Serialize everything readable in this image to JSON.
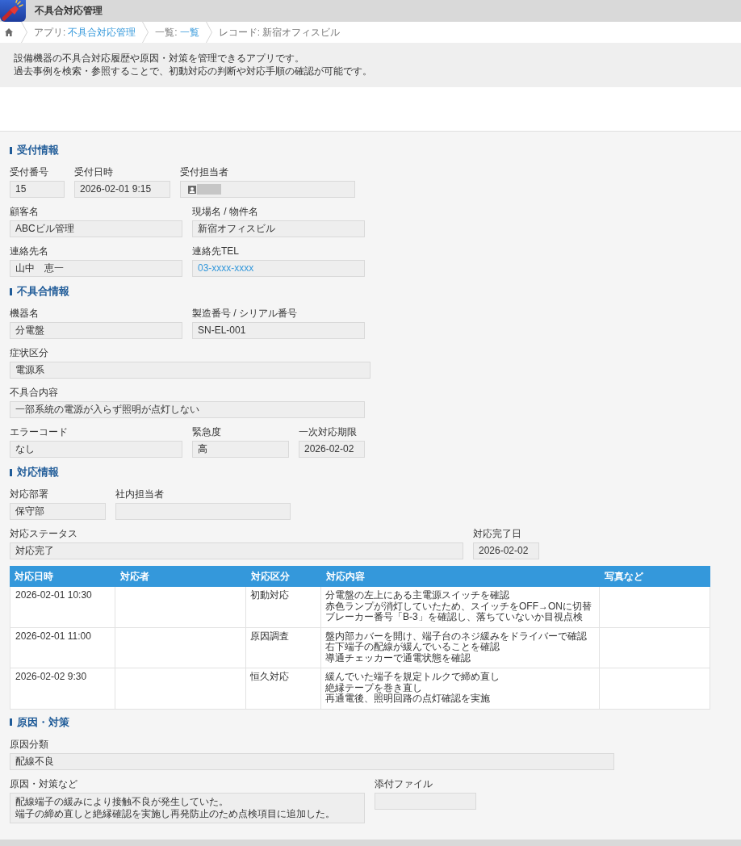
{
  "app": {
    "title": "不具合対応管理"
  },
  "breadcrumb": [
    {
      "kind": "link",
      "label": "アプリ:",
      "value": "不具合対応管理"
    },
    {
      "kind": "link",
      "label": "一覧:",
      "value": "一覧"
    },
    {
      "kind": "text",
      "label": "レコード:",
      "value": "新宿オフィスビル"
    }
  ],
  "description": [
    "設備機器の不具合対応履歴や原因・対策を管理できるアプリです。",
    "過去事例を検索・参照することで、初動対応の判断や対応手順の確認が可能です。"
  ],
  "sections": [
    {
      "title": "受付情報",
      "rows": [
        [
          {
            "label": "受付番号",
            "kind": "text",
            "value": "15"
          },
          {
            "label": "受付日時",
            "kind": "text",
            "value": "2026-02-01 9:15"
          },
          {
            "label": "受付担当者",
            "kind": "user"
          }
        ],
        [
          {
            "label": "顧客名",
            "kind": "text",
            "value": "ABCビル管理"
          },
          {
            "label": "現場名 / 物件名",
            "kind": "text",
            "value": "新宿オフィスビル"
          }
        ],
        [
          {
            "label": "連絡先名",
            "kind": "text",
            "value": "山中　恵一"
          },
          {
            "label": "連絡先TEL",
            "kind": "link",
            "value": "03-xxxx-xxxx"
          }
        ]
      ]
    },
    {
      "title": "不具合情報",
      "rows": [
        [
          {
            "label": "機器名",
            "kind": "text",
            "value": "分電盤"
          },
          {
            "label": "製造番号 / シリアル番号",
            "kind": "text",
            "value": "SN-EL-001"
          }
        ],
        [
          {
            "label": "症状区分",
            "kind": "text",
            "value": "電源系"
          }
        ],
        [
          {
            "label": "不具合内容",
            "kind": "text",
            "value": "一部系統の電源が入らず照明が点灯しない"
          }
        ],
        [
          {
            "label": "エラーコード",
            "kind": "text",
            "value": "なし"
          },
          {
            "label": "緊急度",
            "kind": "text",
            "value": "高"
          },
          {
            "label": "一次対応期限",
            "kind": "text",
            "value": "2026-02-02"
          }
        ]
      ]
    },
    {
      "title": "対応情報",
      "rows": [
        [
          {
            "label": "対応部署",
            "kind": "text",
            "value": "保守部"
          },
          {
            "label": "社内担当者",
            "kind": "text"
          }
        ],
        [
          {
            "label": "対応ステータス",
            "kind": "text",
            "value": "対応完了"
          },
          {
            "label": "対応完了日",
            "kind": "text",
            "value": "2026-02-02"
          }
        ]
      ],
      "table": {
        "columns": [
          "対応日時",
          "対応者",
          "対応区分",
          "対応内容",
          "写真など"
        ],
        "rows": [
          {
            "datetime": "2026-02-01 10:30",
            "category": "初動対応",
            "details": [
              "分電盤の左上にある主電源スイッチを確認",
              "赤色ランプが消灯していたため、スイッチをOFF→ONに切替",
              "ブレーカー番号「B-3」を確認し、落ちていないか目視点検"
            ]
          },
          {
            "datetime": "2026-02-01 11:00",
            "category": "原因調査",
            "details": [
              "盤内部カバーを開け、端子台のネジ緩みをドライバーで確認",
              "右下端子の配線が緩んでいることを確認",
              "導通チェッカーで通電状態を確認"
            ]
          },
          {
            "datetime": "2026-02-02 9:30",
            "category": "恒久対応",
            "details": [
              "緩んでいた端子を規定トルクで締め直し",
              "絶縁テープを巻き直し",
              "再通電後、照明回路の点灯確認を実施"
            ]
          }
        ]
      }
    },
    {
      "title": "原因・対策",
      "rows": [
        [
          {
            "label": "原因分類",
            "kind": "text",
            "value": "配線不良"
          }
        ],
        [
          {
            "label": "原因・対策など",
            "kind": "multiline",
            "lines": [
              "配線端子の緩みにより接触不良が発生していた。",
              "端子の締め直しと絶縁確認を実施し再発防止のため点検項目に追加した。"
            ]
          },
          {
            "label": "添付ファイル",
            "kind": "text"
          }
        ]
      ]
    }
  ]
}
